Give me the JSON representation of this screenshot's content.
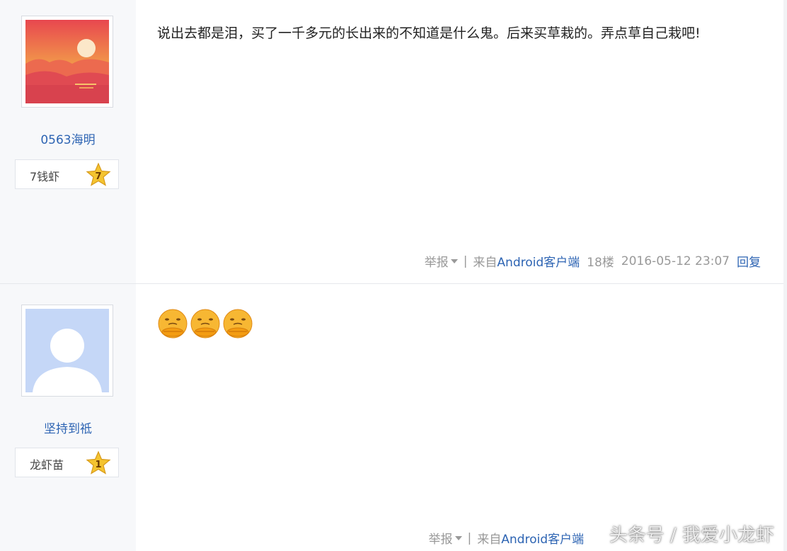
{
  "posts": [
    {
      "username": "0563海明",
      "level_name": "7钱虾",
      "level_number": "7",
      "content": "说出去都是泪，买了一千多元的长出来的不知道是什么鬼。后来买草栽的。弄点草自己栽吧!",
      "footer": {
        "report": "举报",
        "separator": "|",
        "from_prefix": "来自",
        "client": "Android客户端",
        "floor": "18楼",
        "time": "2016-05-12 23:07",
        "reply": "回复"
      }
    },
    {
      "username": "坚持到祗",
      "level_name": "龙虾苗",
      "level_number": "1",
      "emojis": [
        "crossed-arms-face-icon",
        "crossed-arms-face-icon",
        "crossed-arms-face-icon"
      ],
      "footer": {
        "report": "举报",
        "separator": "|",
        "from_prefix": "来自",
        "client": "Android客户端"
      }
    }
  ],
  "watermark": "头条号 / 我爱小龙虾",
  "colors": {
    "link": "#2d64b3",
    "meta": "#999999",
    "sidebar_bg": "#f7f8fa",
    "star_gold": "#f4c430"
  }
}
